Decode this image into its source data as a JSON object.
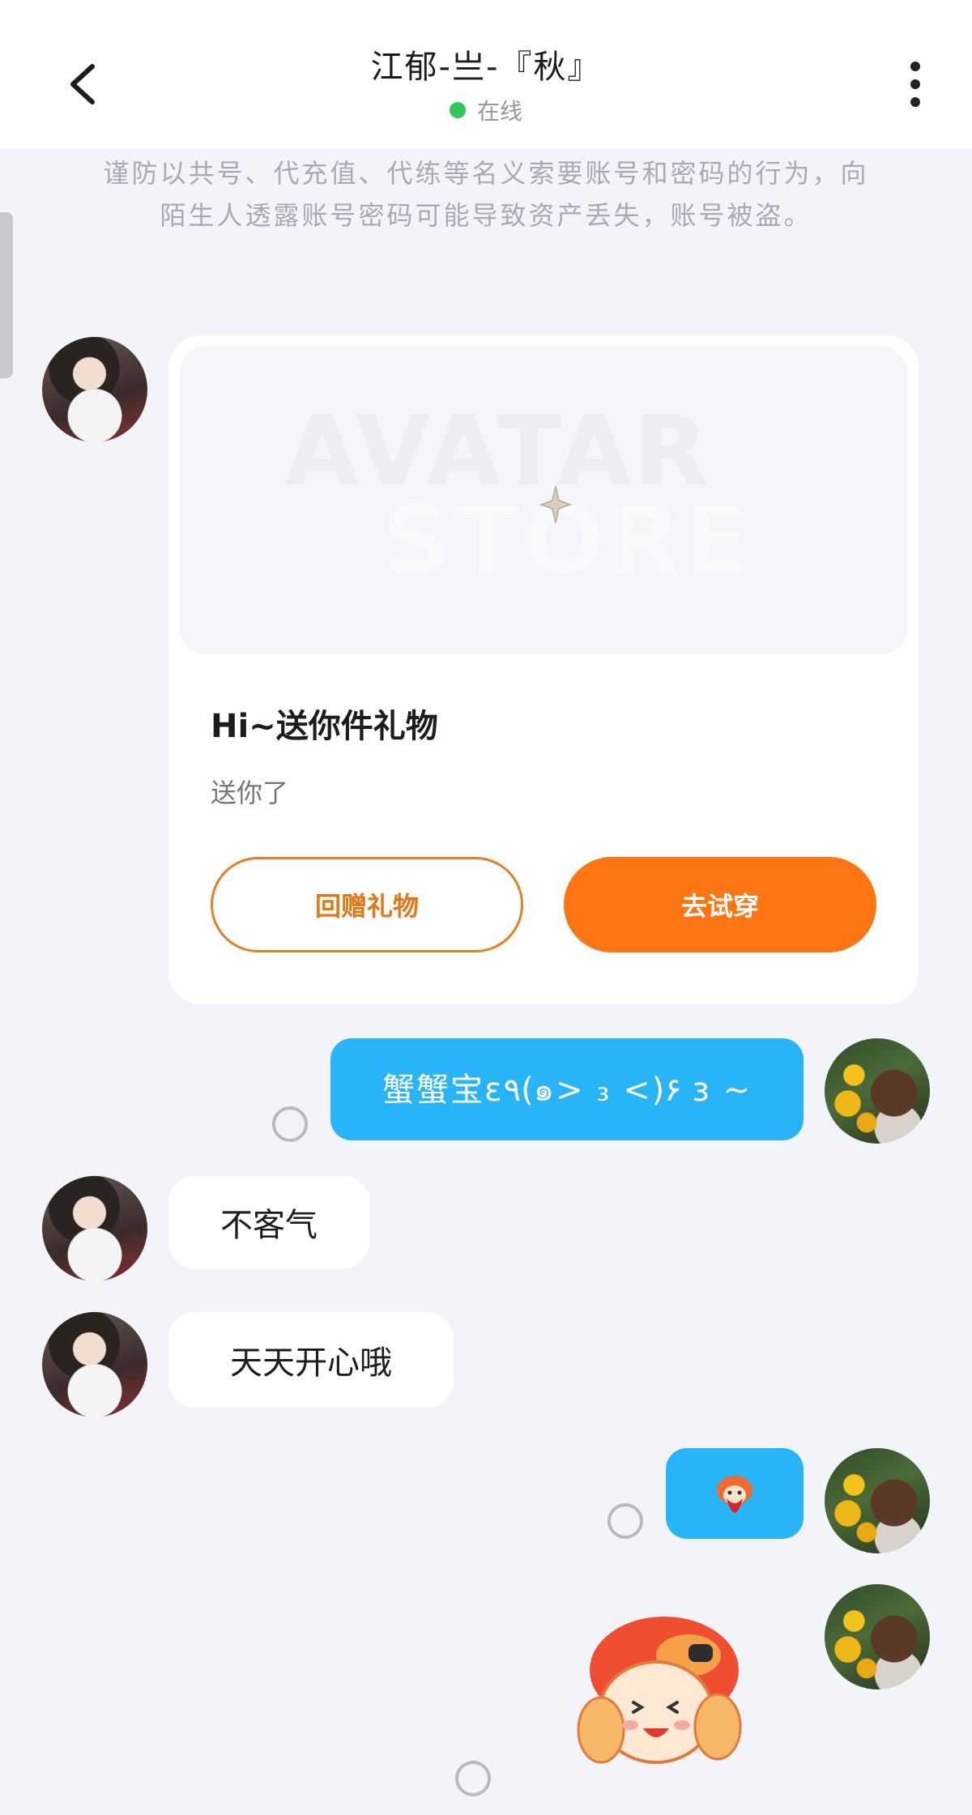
{
  "header": {
    "title": "江郁-亗-『秋』",
    "status": "在线",
    "status_color": "#2fc755"
  },
  "warning": "谨防以共号、代充值、代练等名义索要账号和密码的行为，向陌生人透露账号密码可能导致资产丢失，账号被盗。",
  "gift_card": {
    "watermark_line1": "AVATAR",
    "watermark_line2": "STORE",
    "title": "Hi~送你件礼物",
    "subtitle": "送你了",
    "return_gift_label": "回赠礼物",
    "try_on_label": "去试穿",
    "accent_color": "#fd7613"
  },
  "messages": [
    {
      "side": "right",
      "text": "蟹蟹宝ε٩(๑> ₃ <)۶ з ~"
    },
    {
      "side": "left",
      "text": "不客气"
    },
    {
      "side": "left",
      "text": "天天开心哦"
    },
    {
      "side": "right",
      "sticker": "small-sticker"
    },
    {
      "side": "right",
      "sticker": "large-sticker"
    }
  ],
  "icons": {
    "back": "chevron-left-icon",
    "more": "more-vertical-icon",
    "sparkle": "sparkle-icon",
    "read": "read-status-icon"
  },
  "bubble_color": "#27b4f8"
}
